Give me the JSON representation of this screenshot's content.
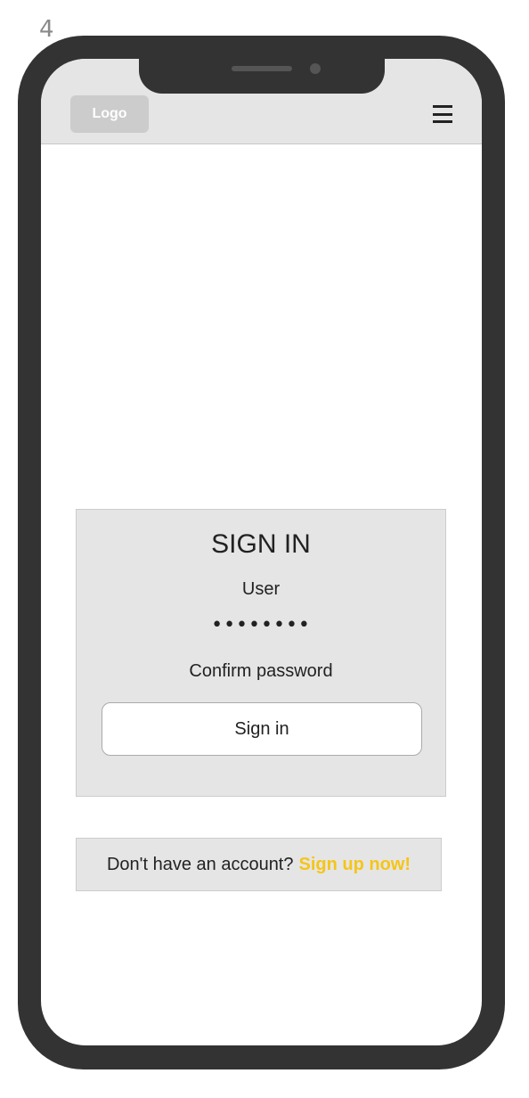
{
  "page_number": "4",
  "header": {
    "logo_label": "Logo",
    "menu_icon": "hamburger-menu-icon"
  },
  "signin": {
    "title": "SIGN IN",
    "user_value": "User",
    "password_value": "••••••••",
    "confirm_value": "Confirm password",
    "button_label": "Sign in"
  },
  "signup": {
    "prompt": "Don't have an account?",
    "link_label": "Sign up now!"
  },
  "colors": {
    "frame": "#333333",
    "header_bg": "#e5e5e5",
    "card_bg": "#e5e5e5",
    "accent": "#f5c518"
  }
}
